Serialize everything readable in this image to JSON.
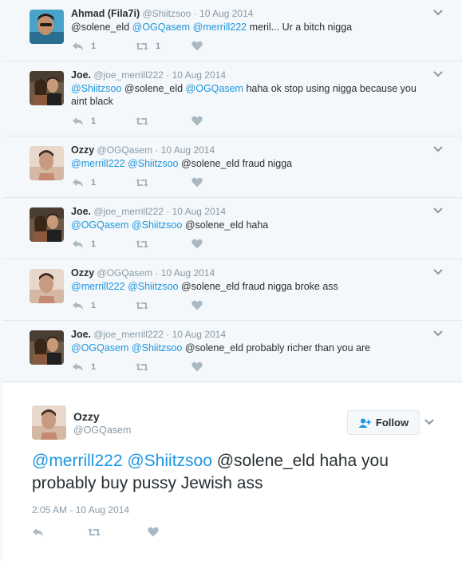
{
  "colors": {
    "link": "#1b95e0",
    "muted": "#8899a6",
    "text": "#292f33",
    "border": "#e1e8ed"
  },
  "replies": [
    {
      "name": "Ahmad (Fila7i)",
      "handle": "@Shiitzsoo",
      "sep": " · ",
      "time": "10 Aug 2014",
      "text_parts": [
        {
          "t": "@solene_eld ",
          "m": false
        },
        {
          "t": "@OGQasem",
          "m": true
        },
        {
          "t": " ",
          "m": false
        },
        {
          "t": "@merrill222",
          "m": true
        },
        {
          "t": " meril... Ur a bitch nigga",
          "m": false
        }
      ],
      "reply_count": "1",
      "retweet_count": "1",
      "like_count": ""
    },
    {
      "name": "Joe.",
      "handle": "@joe_merrill222",
      "sep": " · ",
      "time": "10 Aug 2014",
      "text_parts": [
        {
          "t": "@Shiitzsoo",
          "m": true
        },
        {
          "t": " @solene_eld ",
          "m": false
        },
        {
          "t": "@OGQasem",
          "m": true
        },
        {
          "t": " haha ok stop using nigga because you aint black",
          "m": false
        }
      ],
      "reply_count": "1",
      "retweet_count": "",
      "like_count": ""
    },
    {
      "name": "Ozzy",
      "handle": "@OGQasem",
      "sep": " · ",
      "time": "10 Aug 2014",
      "text_parts": [
        {
          "t": "@merrill222",
          "m": true
        },
        {
          "t": " ",
          "m": false
        },
        {
          "t": "@Shiitzsoo",
          "m": true
        },
        {
          "t": " @solene_eld fraud nigga",
          "m": false
        }
      ],
      "reply_count": "1",
      "retweet_count": "",
      "like_count": ""
    },
    {
      "name": "Joe.",
      "handle": "@joe_merrill222",
      "sep": " · ",
      "time": "10 Aug 2014",
      "text_parts": [
        {
          "t": "@OGQasem",
          "m": true
        },
        {
          "t": " ",
          "m": false
        },
        {
          "t": "@Shiitzsoo",
          "m": true
        },
        {
          "t": " @solene_eld haha",
          "m": false
        }
      ],
      "reply_count": "1",
      "retweet_count": "",
      "like_count": ""
    },
    {
      "name": "Ozzy",
      "handle": "@OGQasem",
      "sep": " · ",
      "time": "10 Aug 2014",
      "text_parts": [
        {
          "t": "@merrill222",
          "m": true
        },
        {
          "t": " ",
          "m": false
        },
        {
          "t": "@Shiitzsoo",
          "m": true
        },
        {
          "t": " @solene_eld fraud nigga broke ass",
          "m": false
        }
      ],
      "reply_count": "1",
      "retweet_count": "",
      "like_count": ""
    },
    {
      "name": "Joe.",
      "handle": "@joe_merrill222",
      "sep": " · ",
      "time": "10 Aug 2014",
      "text_parts": [
        {
          "t": "@OGQasem",
          "m": true
        },
        {
          "t": " ",
          "m": false
        },
        {
          "t": "@Shiitzsoo",
          "m": true
        },
        {
          "t": " @solene_eld probably richer than you are",
          "m": false
        }
      ],
      "reply_count": "1",
      "retweet_count": "",
      "like_count": ""
    }
  ],
  "main": {
    "name": "Ozzy",
    "handle": "@OGQasem",
    "follow_label": "Follow",
    "text_parts": [
      {
        "t": "@merrill222",
        "m": true
      },
      {
        "t": " ",
        "m": false
      },
      {
        "t": "@Shiitzsoo",
        "m": true
      },
      {
        "t": " @solene_eld haha you probably buy pussy Jewish ass",
        "m": false
      }
    ],
    "timestamp": "2:05 AM - 10 Aug 2014"
  },
  "icons": {
    "reply": "reply-icon",
    "retweet": "retweet-icon",
    "like": "heart-icon",
    "more": "chevron-down-icon",
    "follow": "add-user-icon"
  }
}
